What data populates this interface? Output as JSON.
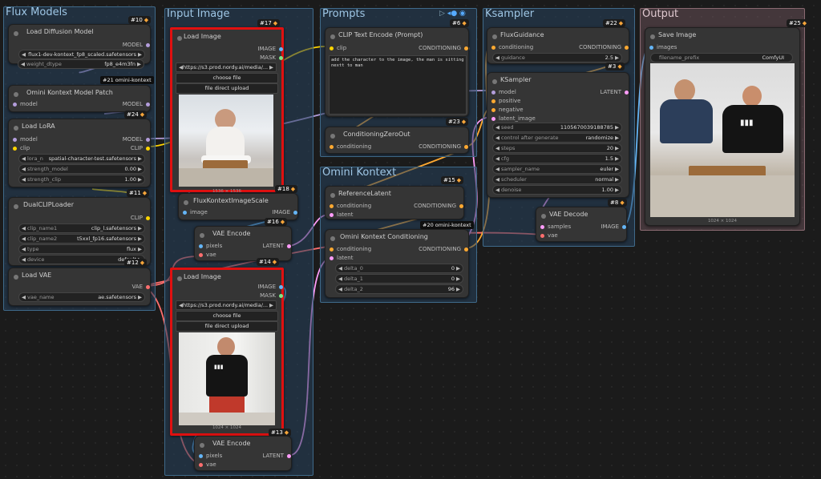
{
  "groups": {
    "flux_models": "Flux Models",
    "input_image": "Input Image",
    "prompts": "Prompts",
    "ksampler": "Ksampler",
    "output": "Output",
    "omini_kontext": "Omini Kontext"
  },
  "colors": {
    "pin_model": "#b39ddb",
    "pin_clip": "#ffd500",
    "pin_cond": "#ffa931",
    "pin_latent": "#ff9cf9",
    "pin_vae": "#ff6e6e",
    "pin_image": "#64b5f6",
    "selected": "#e01010"
  },
  "nodes": {
    "load_diffusion": {
      "title": "Load Diffusion Model",
      "badge": "#10",
      "out": "MODEL",
      "unet": "flux1-dev-kontext_fp8_scaled.safetensors",
      "dtype_label": "weight_dtype",
      "dtype": "fp8_e4m3fn"
    },
    "chip21": "#21 omini-kontext",
    "omini_patch": {
      "title": "Omini Kontext Model Patch",
      "in": "model",
      "out": "MODEL",
      "badge": "#24"
    },
    "lora": {
      "title": "Load LoRA",
      "badge": "#24",
      "in_model": "model",
      "in_clip": "clip",
      "out_model": "MODEL",
      "out_clip": "CLIP",
      "name_label": "lora_n",
      "name": "spatial-character-test.safetensors",
      "sm_label": "strength_model",
      "sm": "0.00",
      "sc_label": "strength_clip",
      "sc": "1.00"
    },
    "dualclip": {
      "title": "DualCLIPLoader",
      "badge": "#11",
      "out": "CLIP",
      "c1_label": "clip_name1",
      "c1": "clip_l.safetensors",
      "c2_label": "clip_name2",
      "c2": "t5xxl_fp16.safetensors",
      "type_label": "type",
      "type": "flux",
      "dev_label": "device",
      "dev": "default",
      "badge2": "#12"
    },
    "loadvae": {
      "title": "Load VAE",
      "out": "VAE",
      "name_label": "vae_name",
      "name": "ae.safetensors"
    },
    "loadimg1": {
      "title": "Load Image",
      "badge": "#17",
      "out_img": "IMAGE",
      "out_mask": "MASK",
      "url": "https://s3.prod.nordy.ai/media/...",
      "choose": "choose file",
      "upload": "file direct upload",
      "size": "1536 × 1536",
      "badge2": "#18"
    },
    "fluxscale": {
      "title": "FluxKontextImageScale",
      "in": "image",
      "out": "IMAGE",
      "badge": "#16"
    },
    "vaeenc1": {
      "title": "VAE Encode",
      "in_pix": "pixels",
      "in_vae": "vae",
      "out": "LATENT",
      "badge": "#14"
    },
    "loadimg2": {
      "title": "Load Image",
      "out_img": "IMAGE",
      "out_mask": "MASK",
      "url": "https://s3.prod.nordy.ai/media/...",
      "choose": "choose file",
      "upload": "file direct upload",
      "size": "1024 × 1024",
      "badge2": "#13"
    },
    "vaeenc2": {
      "title": "VAE Encode",
      "in_pix": "pixels",
      "in_vae": "vae",
      "out": "LATENT"
    },
    "clipenc": {
      "title": "CLIP Text Encode (Prompt)",
      "badge": "#6",
      "in": "clip",
      "out": "CONDITIONING",
      "text": "add the character to the image, the man is sitting nextt to man"
    },
    "condzero": {
      "title": "ConditioningZeroOut",
      "in": "conditioning",
      "out": "CONDITIONING",
      "badge": "#23"
    },
    "reflatent": {
      "title": "ReferenceLatent",
      "badge": "#15",
      "in_cond": "conditioning",
      "in_lat": "latent",
      "out": "CONDITIONING"
    },
    "chip20": "#20 omini-kontext",
    "omini_cond": {
      "title": "Omini Kontext Conditioning",
      "in_cond": "conditioning",
      "in_lat": "latent",
      "out": "CONDITIONING",
      "d0_label": "delta_0",
      "d0": "0",
      "d1_label": "delta_1",
      "d1": "0",
      "d2_label": "delta_2",
      "d2": "96"
    },
    "fluxguid": {
      "title": "FluxGuidance",
      "badge": "#22",
      "in": "conditioning",
      "out": "CONDITIONING",
      "g_label": "guidance",
      "g": "2.5",
      "badge2": "#3"
    },
    "ksampler": {
      "title": "KSampler",
      "in_model": "model",
      "in_pos": "positive",
      "in_neg": "negative",
      "in_lat": "latent_image",
      "out": "LATENT",
      "w": [
        {
          "l": "seed",
          "v": "1105670039188785"
        },
        {
          "l": "control after generate",
          "v": "randomize"
        },
        {
          "l": "steps",
          "v": "20"
        },
        {
          "l": "cfg",
          "v": "1.5"
        },
        {
          "l": "sampler_name",
          "v": "euler"
        },
        {
          "l": "scheduler",
          "v": "normal"
        },
        {
          "l": "denoise",
          "v": "1.00"
        }
      ],
      "badge2": "#8"
    },
    "vaedecode": {
      "title": "VAE Decode",
      "in_samples": "samples",
      "in_vae": "vae",
      "out": "IMAGE"
    },
    "saveimg": {
      "title": "Save Image",
      "badge": "#25",
      "in": "images",
      "fp_label": "filename_prefix",
      "fp": "ComfyUI",
      "size": "1024 × 1024"
    }
  }
}
